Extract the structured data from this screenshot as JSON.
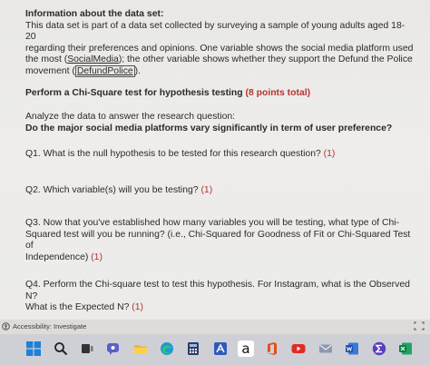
{
  "document": {
    "info_heading": "Information about the data set:",
    "info_line1": "This data set is part of a data set collected by surveying a sample of young adults aged 18-20",
    "info_line2": "regarding their preferences and opinions. One variable shows the social media platform used",
    "info_line3_prefix": "the most (",
    "info_link1": "SocialMedia",
    "info_line3_suffix": "); the other variable shows whether they support the Defund the Police",
    "info_line4_prefix": "movement (",
    "info_link2": "DefundPolice",
    "info_line4_suffix": ").",
    "task_heading": "Perform a Chi-Square test for hypothesis testing ",
    "task_points": "(8 points total)",
    "analyze_line": "Analyze the data to answer the research question:",
    "research_question": "Do the major social media platforms vary significantly in term of user preference?",
    "q1_text": "Q1. What is the null hypothesis to be tested for this research question? ",
    "q1_points": "(1)",
    "q2_text": "Q2. Which variable(s) will you be testing? ",
    "q2_points": "(1)",
    "q3_line1": "Q3. Now that you've established how many variables you will be testing, what type of Chi-",
    "q3_line2": "Squared test will you be running? (i.e., Chi-Squared for Goodness of Fit or Chi-Squared Test of",
    "q3_line3": "Independence) ",
    "q3_points": "(1)",
    "q4_line1": "Q4. Perform the Chi-square test to test this hypothesis. For Instagram, what is the Observed N?",
    "q4_line2": "What is the Expected N? ",
    "q4_points": "(1)"
  },
  "statusbar": {
    "accessibility": "Accessibility: Investigate"
  },
  "taskbar": {
    "amazon_glyph": "a"
  },
  "colors": {
    "points_red": "#b8322e",
    "taskbar_bg": "#cfd0d6",
    "windows_blue": "#1f7fd8"
  }
}
